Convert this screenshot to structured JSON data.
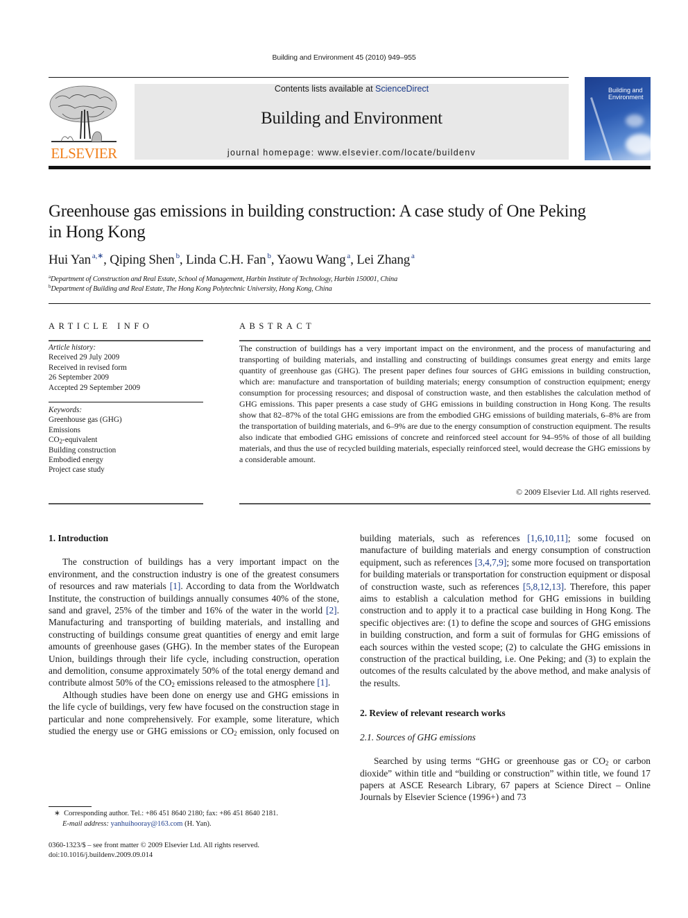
{
  "running_head": "Building and Environment 45 (2010) 949–955",
  "publisher_logo": {
    "icon": "elsevier-tree-icon",
    "wordmark": "ELSEVIER",
    "color": "#f07f1a"
  },
  "banner": {
    "contents_prefix": "Contents lists available at ",
    "contents_link": "ScienceDirect",
    "journal_title": "Building and Environment",
    "homepage_label": "journal homepage: www.elsevier.com/locate/buildenv"
  },
  "cover": {
    "icon": "journal-cover-image",
    "title_line1": "Building and",
    "title_line2": "Environment"
  },
  "article": {
    "title_line1": "Greenhouse gas emissions in building construction: A case study of One Peking",
    "title_line2": "in Hong Kong",
    "authors": [
      {
        "name": "Hui Yan",
        "sup": "a,∗",
        "sep": ", "
      },
      {
        "name": "Qiping Shen",
        "sup": "b",
        "sep": ", "
      },
      {
        "name": "Linda C.H. Fan",
        "sup": "b",
        "sep": ", "
      },
      {
        "name": "Yaowu Wang",
        "sup": "a",
        "sep": ", "
      },
      {
        "name": "Lei Zhang",
        "sup": "a",
        "sep": ""
      }
    ],
    "affiliations": [
      {
        "mark": "a",
        "text": "Department of Construction and Real Estate, School of Management, Harbin Institute of Technology, Harbin 150001, China"
      },
      {
        "mark": "b",
        "text": "Department of Building and Real Estate, The Hong Kong Polytechnic University, Hong Kong, China"
      }
    ]
  },
  "article_info": {
    "heading": "ARTICLE INFO",
    "history_label": "Article history:",
    "history": [
      "Received 29 July 2009",
      "Received in revised form",
      "26 September 2009",
      "Accepted 29 September 2009"
    ],
    "keywords_label": "Keywords:",
    "keywords": [
      "Greenhouse gas (GHG)",
      "Emissions",
      "CO",
      "Building construction",
      "Embodied energy",
      "Project case study"
    ],
    "keyword_co2_sub": "2",
    "keyword_co2_suffix": "-equivalent"
  },
  "abstract": {
    "heading": "ABSTRACT",
    "text": "The construction of buildings has a very important impact on the environment, and the process of manufacturing and transporting of building materials, and installing and constructing of buildings consumes great energy and emits large quantity of greenhouse gas (GHG). The present paper defines four sources of GHG emissions in building construction, which are: manufacture and transportation of building materials; energy consumption of construction equipment; energy consumption for processing resources; and disposal of construction waste, and then establishes the calculation method of GHG emissions. This paper presents a case study of GHG emissions in building construction in Hong Kong. The results show that 82–87% of the total GHG emissions are from the embodied GHG emissions of building materials, 6–8% are from the transportation of building materials, and 6–9% are due to the energy consumption of construction equipment. The results also indicate that embodied GHG emissions of concrete and reinforced steel account for 94–95% of those of all building materials, and thus the use of recycled building materials, especially reinforced steel, would decrease the GHG emissions by a considerable amount.",
    "copyright": "© 2009 Elsevier Ltd. All rights reserved."
  },
  "body": {
    "sec1_heading": "1.  Introduction",
    "p1_a": "The construction of buildings has a very important impact on the environment, and the construction industry is one of the greatest consumers of resources and raw materials ",
    "p1_ref1": "[1]",
    "p1_b": ". According to data from the Worldwatch Institute, the construction of buildings annually consumes 40% of the stone, sand and gravel, 25% of the timber and 16% of the water in the world ",
    "p1_ref2": "[2]",
    "p1_c": ". Manufacturing and transporting of building materials, and installing and constructing of buildings consume great quantities of energy and emit large amounts of greenhouse gases (GHG). In the member states of the European Union, buildings through their life cycle, including construction, operation and demolition, consume approximately 50% of the total energy demand and contribute almost 50% of the CO",
    "p1_sub": "2",
    "p1_d": " emissions released to the atmosphere ",
    "p1_ref3": "[1]",
    "p1_e": ".",
    "p2_a": "Although studies have been done on energy use and GHG emissions in the life cycle of buildings, very few have focused on the construction stage in particular and none comprehensively. For example, some literature, which studied the energy use or GHG emissions or CO",
    "p2_sub": "2",
    "p2_b": " emission, only focused on manufacture of building materials, such as references ",
    "p2_ref1": "[1,6,10,11]",
    "p2_c": "; some focused on manufacture of building materials and energy consumption of construction equipment, such as references ",
    "p2_ref2": "[3,4,7,9]",
    "p2_d": "; some more focused on transportation for building materials or transportation for construction equipment or disposal of construction waste, such as references ",
    "p2_ref3": "[5,8,12,13]",
    "p2_e": ". Therefore, this paper aims to establish a calculation method for GHG emissions in building construction and to apply it to a practical case building in Hong Kong. The specific objectives are: (1) to define the scope and sources of GHG emissions in building construction, and form a suit of formulas for GHG emissions of each sources within the vested scope; (2) to calculate the GHG emissions in construction of the practical building, i.e. One Peking; and (3) to explain the outcomes of the results calculated by the above method, and make analysis of the results.",
    "sec2_heading": "2.  Review of relevant research works",
    "sec21_heading": "2.1.  Sources of GHG emissions",
    "p3_a": "Searched by using terms “GHG or greenhouse gas or CO",
    "p3_sub": "2",
    "p3_b": " or carbon dioxide” within title and “building or construction” within title, we found 17 papers at ASCE Research Library, 67 papers at Science Direct – Online Journals by Elsevier Science (1996+) and 73"
  },
  "footnote": {
    "mark": "∗",
    "corresponding": "Corresponding author. Tel.: +86 451 8640 2180; fax: +86 451 8640 2181.",
    "email_label": "E-mail address: ",
    "email": "yanhuihooray@163.com",
    "email_suffix": " (H. Yan)."
  },
  "front_matter": {
    "issn_line": "0360-1323/$ – see front matter © 2009 Elsevier Ltd. All rights reserved.",
    "doi": "doi:10.1016/j.buildenv.2009.09.014"
  }
}
